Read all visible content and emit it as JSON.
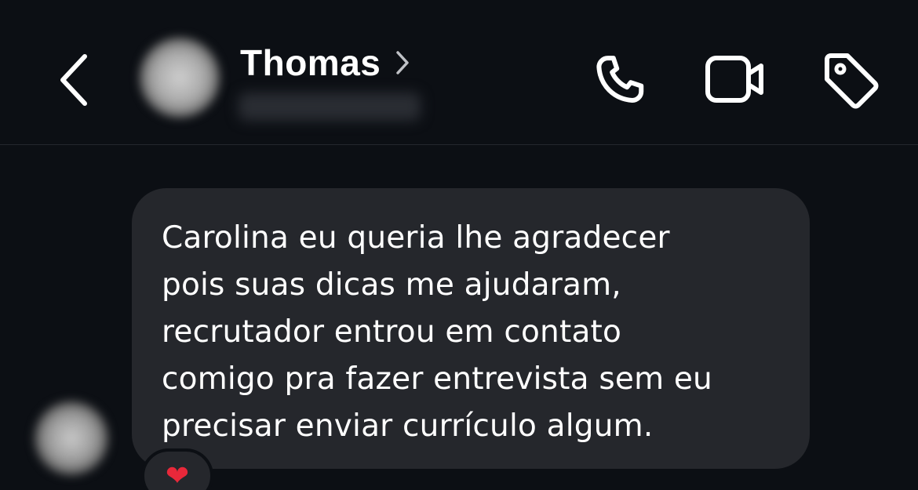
{
  "header": {
    "contact_name": "Thomas",
    "back_icon": "chevron-left-icon",
    "name_chevron_icon": "chevron-right-icon",
    "actions": [
      {
        "name": "phone-call",
        "icon": "phone-icon"
      },
      {
        "name": "video-call",
        "icon": "video-camera-icon"
      },
      {
        "name": "tag",
        "icon": "tag-icon"
      }
    ]
  },
  "message": {
    "text": "Carolina eu queria lhe agradecer\npois suas dicas me ajudaram,\nrecrutador entrou em contato\ncomigo pra fazer entrevista sem eu\nprecisar enviar currículo algum.",
    "reaction": "❤"
  },
  "colors": {
    "background": "#0c0f14",
    "bubble": "#25272c",
    "text": "#ffffff",
    "divider": "#24272d",
    "reaction_heart": "#e8283a"
  }
}
